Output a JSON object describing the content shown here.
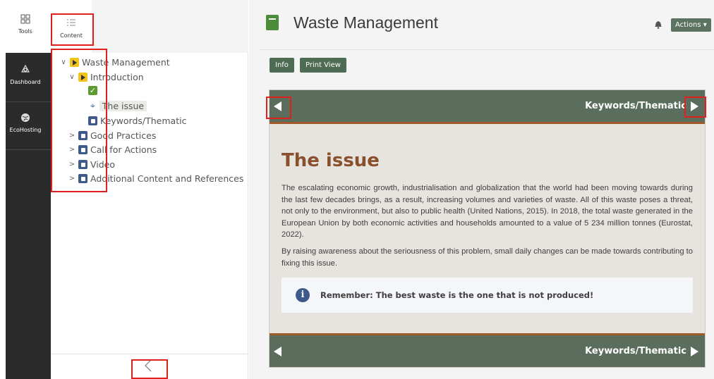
{
  "toolbar": {
    "tools_label": "Tools",
    "content_label": "Content",
    "dashboard_label": "Dashboard",
    "ecohosting_label": "EcoHosting"
  },
  "tree": {
    "root": "Waste Management",
    "introduction": "Introduction",
    "current": "The issue",
    "keywords": "Keywords/Thematic",
    "good_practices": "Good Practices",
    "call_for_actions": "Call for Actions",
    "video": "Video",
    "additional": "Additional Content and References"
  },
  "header": {
    "title": "Waste Management",
    "actions_label": "Actions ▾",
    "info_label": "Info",
    "print_label": "Print View"
  },
  "navigation": {
    "next_label": "Keywords/Thematic"
  },
  "content": {
    "title": "The issue",
    "paragraph1": "The escalating economic growth, industrialisation and globalization that the world had been moving towards during the last few decades brings, as a result, increasing volumes and varieties of waste. All of this waste poses a threat, not only to the environment, but also to public health (United Nations, 2015). In 2018, the total waste generated in the European Union by both economic activities and households amounted to a value of 5 234 million tonnes (Eurostat, 2022).",
    "paragraph2": "By raising awareness about the seriousness of this problem, small daily changes can be made towards contributing to fixing this issue.",
    "note": "Remember: The best waste is the one that is not produced!"
  },
  "colors": {
    "accent_green": "#5b6e5e",
    "title_brown": "#8a4f2c",
    "highlight_red": "#e0201c"
  }
}
